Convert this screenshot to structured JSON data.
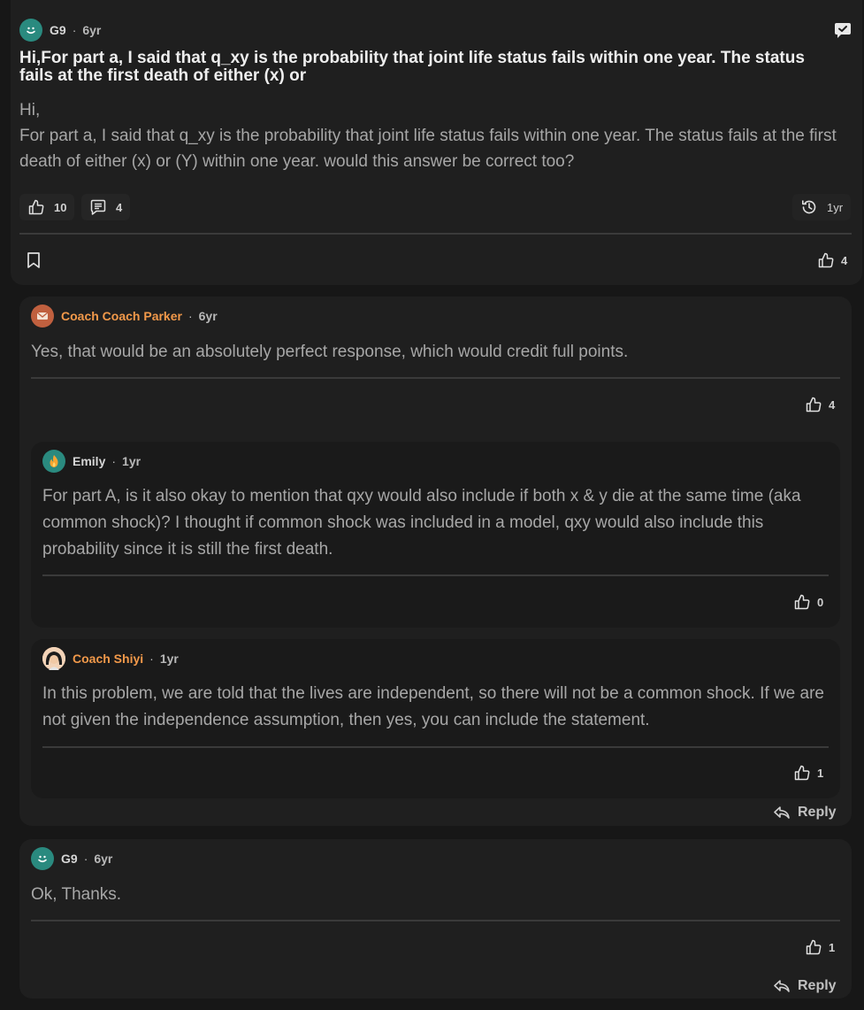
{
  "post": {
    "author": "G9",
    "time": "6yr",
    "title": "Hi,For part a, I said that q_xy is the probability that joint life status fails within one year. The status fails at the first death of either (x) or",
    "body_line1": "Hi,",
    "body_line2": "For part a, I said that q_xy is the probability that joint life status fails within one year. The status fails at the first death of either (x) or (Y) within one year. would this answer be correct too?",
    "likes": "10",
    "comments": "4",
    "history_time": "1yr",
    "bottom_likes": "4"
  },
  "comments": [
    {
      "author": "Coach Coach Parker",
      "time": "6yr",
      "text": "Yes, that would be an absolutely perfect response, which would credit full points.",
      "likes": "4"
    },
    {
      "author": "Emily",
      "time": "1yr",
      "text": "For part A, is it also okay to mention that qxy would also include if both x & y die at the same time (aka common shock)? I thought if common shock was included in a model, qxy would also include this probability since it is still the first death.",
      "likes": "0"
    },
    {
      "author": "Coach Shiyi",
      "time": "1yr",
      "text": "In this problem, we are told that the lives are independent, so there will not be a common shock. If we are not given the independence assumption, then yes, you can include the statement.",
      "likes": "1"
    },
    {
      "author": "G9",
      "time": "6yr",
      "text": "Ok, Thanks.",
      "likes": "1"
    }
  ],
  "reply_label": "Reply",
  "colors": {
    "background": "#171717",
    "card": "#1f1f1f",
    "coach_name": "#f2994a",
    "avatar_teal": "#2a8a7f"
  },
  "icons": [
    "smile-avatar-icon",
    "feedback-icon",
    "thumbs-up-icon",
    "comment-icon",
    "history-icon",
    "bookmark-icon",
    "reply-icon"
  ]
}
